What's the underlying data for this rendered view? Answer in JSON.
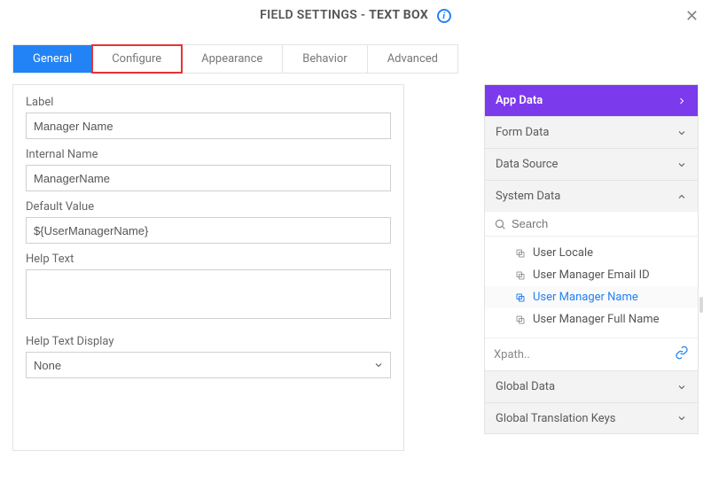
{
  "header": {
    "title_prefix": "FIELD SETTINGS - ",
    "title_type": "TEXT BOX"
  },
  "tabs": {
    "items": [
      "General",
      "Configure",
      "Appearance",
      "Behavior",
      "Advanced"
    ],
    "active": 0,
    "highlight": 1
  },
  "form": {
    "label_label": "Label",
    "label_value": "Manager Name",
    "internal_label": "Internal Name",
    "internal_value": "ManagerName",
    "default_label": "Default Value",
    "default_value": "${UserManagerName}",
    "helptext_label": "Help Text",
    "helptext_value": "",
    "helpdisplay_label": "Help Text Display",
    "helpdisplay_value": "None"
  },
  "right": {
    "app_data_label": "App Data",
    "form_data_label": "Form Data",
    "data_source_label": "Data Source",
    "system_data_label": "System Data",
    "search_placeholder": "Search",
    "items": [
      {
        "label": "User Locale"
      },
      {
        "label": "User Manager Email ID"
      },
      {
        "label": "User Manager Name",
        "selected": true
      },
      {
        "label": "User Manager Full Name"
      }
    ],
    "xpath_label": "Xpath..",
    "global_data_label": "Global Data",
    "global_trans_label": "Global Translation Keys"
  }
}
